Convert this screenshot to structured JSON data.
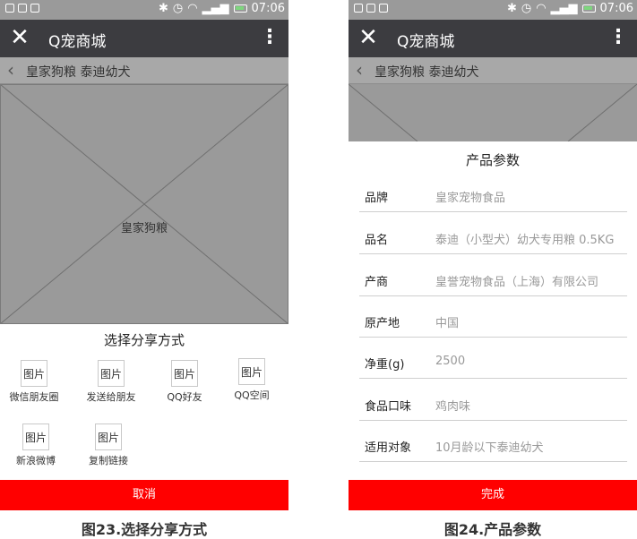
{
  "statusbar": {
    "time": "07:06"
  },
  "app": {
    "title": "Q宠商城",
    "nav_title": "皇家狗粮 泰迪幼犬"
  },
  "left": {
    "hero_label": "皇家狗粮",
    "share_title": "选择分享方式",
    "placeholder_text": "图片",
    "share_items": [
      "微信朋友圈",
      "发送给朋友",
      "QQ好友",
      "QQ空间",
      "新浪微博",
      "复制链接"
    ],
    "cancel_label": "取消",
    "caption": "图23.选择分享方式"
  },
  "right": {
    "params_title": "产品参数",
    "params": [
      {
        "label": "品牌",
        "value": "皇家宠物食品"
      },
      {
        "label": "品名",
        "value": "泰迪（小型犬）幼犬专用粮 0.5KG"
      },
      {
        "label": "产商",
        "value": "皇誉宠物食品（上海）有限公司"
      },
      {
        "label": "原产地",
        "value": "中国"
      },
      {
        "label": "净重(g)",
        "value": "2500"
      },
      {
        "label": "食品口味",
        "value": "鸡肉味"
      },
      {
        "label": "适用对象",
        "value": "10月龄以下泰迪幼犬"
      }
    ],
    "done_label": "完成",
    "caption": "图24.产品参数"
  },
  "colors": {
    "titlebar": "#3c3c40",
    "action": "#ff0000",
    "placeholder": "#9a9a9a"
  }
}
